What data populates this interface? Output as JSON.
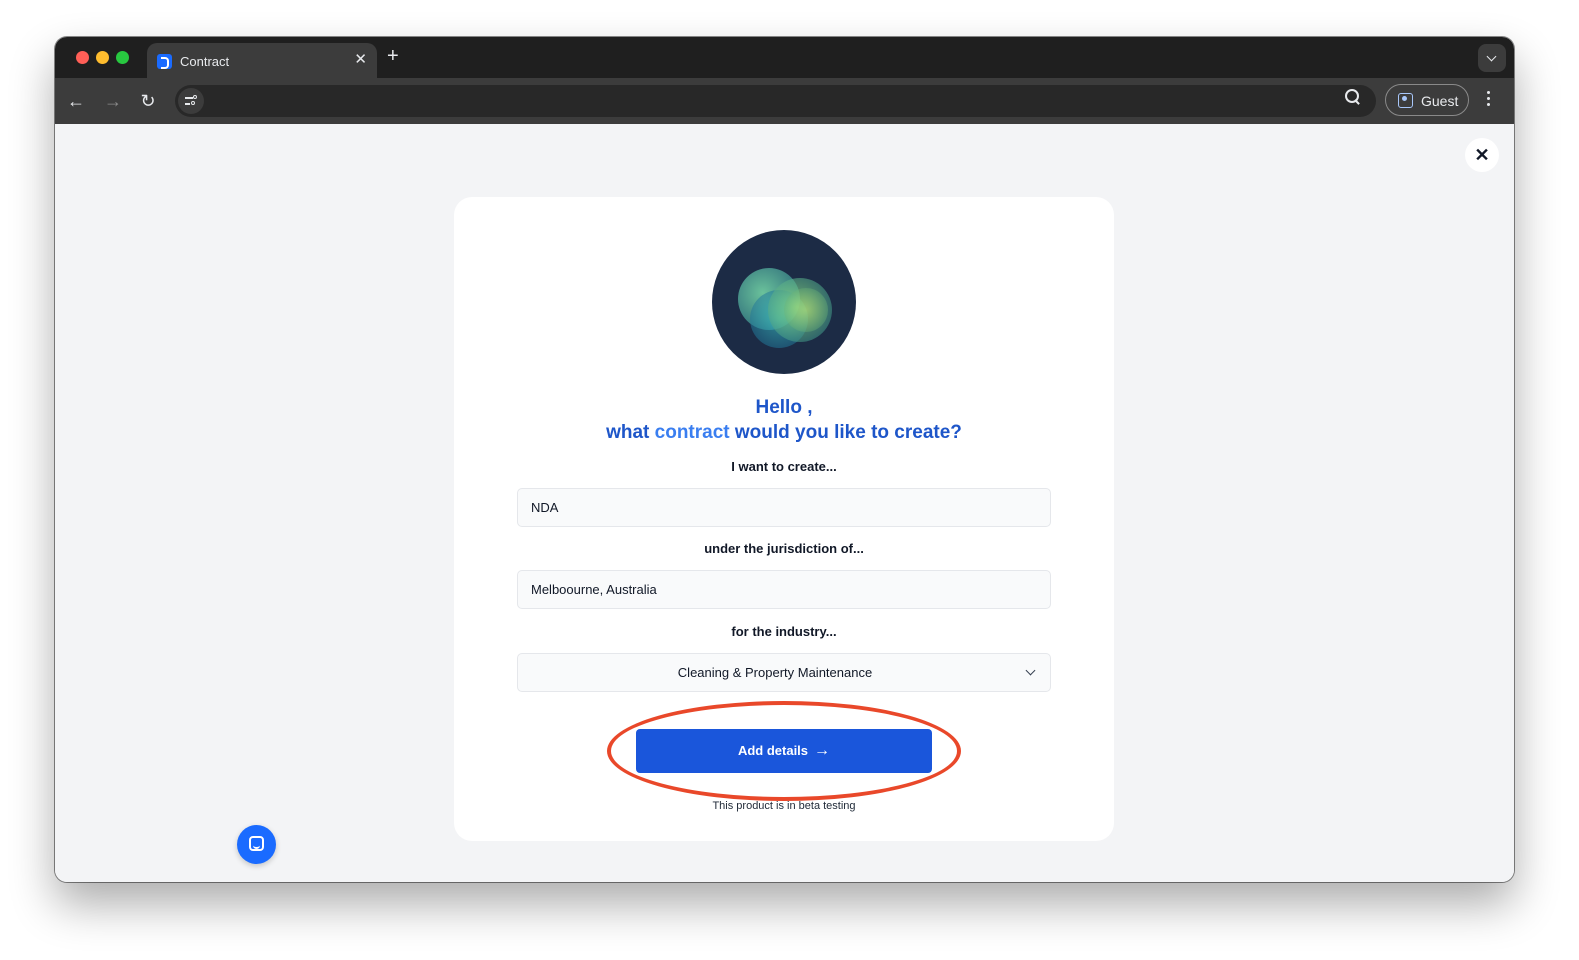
{
  "browser": {
    "tab_title": "Contract",
    "tab_close": "✕",
    "new_tab": "+",
    "profile_label": "Guest",
    "url": ""
  },
  "page": {
    "close_symbol": "✕",
    "greeting": "Hello ,",
    "question_prefix": "what ",
    "question_highlight": "contract",
    "question_suffix": " would you like to create?",
    "create_label": "I want to create...",
    "create_value": "NDA",
    "jurisdiction_label": "under the jurisdiction of...",
    "jurisdiction_value": "Melboourne, Australia",
    "industry_label": "for the industry...",
    "industry_value": "Cleaning & Property Maintenance",
    "submit_label": "Add details",
    "submit_arrow": "→",
    "beta_note": "This product is in beta testing"
  },
  "colors": {
    "primary": "#1a56db",
    "heading": "#1e56c9",
    "highlight": "#3a7ef0",
    "annotation": "#e9482a"
  },
  "icons": [
    "tab-favicon-icon",
    "close-icon",
    "back-arrow-icon",
    "forward-arrow-icon",
    "reload-icon",
    "site-info-icon",
    "zoom-icon",
    "guest-profile-icon",
    "menu-dots-icon",
    "chevron-down-icon",
    "arrow-right-icon",
    "chat-icon"
  ]
}
